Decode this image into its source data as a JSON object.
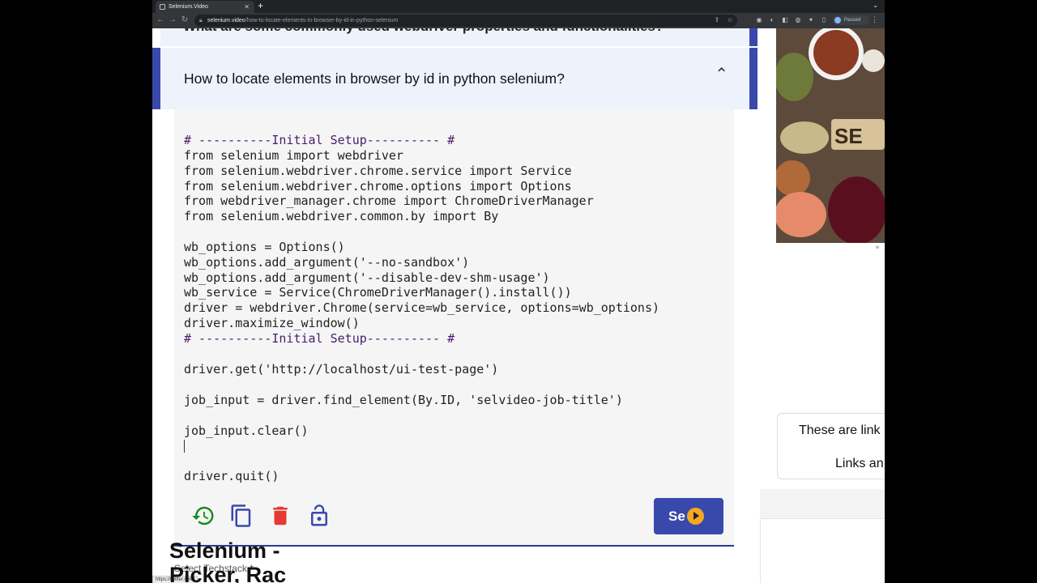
{
  "browser": {
    "tab_title": "Selenium.Video",
    "new_tab": "+",
    "url_host": "selenium.video",
    "url_path": "/how-to-locate-elements-in-browser-by-id-in-python-selenium",
    "profile_status": "Paused",
    "status_url": "https://twitter.com/"
  },
  "page": {
    "prev_question": "What are some commonly used webdriver properties and functionalities?",
    "question": "How to locate elements in browser by id in python selenium?",
    "code_lines": [
      "# ----------Initial Setup---------- #",
      "from selenium import webdriver",
      "from selenium.webdriver.chrome.service import Service",
      "from selenium.webdriver.chrome.options import Options",
      "from webdriver_manager.chrome import ChromeDriverManager",
      "from selenium.webdriver.common.by import By",
      "",
      "wb_options = Options()",
      "wb_options.add_argument('--no-sandbox')",
      "wb_options.add_argument('--disable-dev-shm-usage')",
      "wb_service = Service(ChromeDriverManager().install())",
      "driver = webdriver.Chrome(service=wb_service, options=wb_options)",
      "driver.maximize_window()",
      "# ----------Initial Setup---------- #",
      "",
      "driver.get('http://localhost/ui-test-page')",
      "",
      "job_input = driver.find_element(By.ID, 'selvideo-job-title')",
      "",
      "job_input.clear()",
      "",
      "",
      "driver.quit()"
    ],
    "run_label": "Se",
    "techstack_label": "Select Techstack *"
  },
  "sidebar": {
    "ad_text": "SE",
    "links_line1": "These are link",
    "links_line2": "Links an",
    "promo_line1": "Selenium -",
    "promo_line2": "Picker, Rac"
  },
  "colors": {
    "accent": "#3949ab",
    "play": "#f5a623",
    "history_icon": "#1a8a1a",
    "delete_icon": "#e53935",
    "code_keyword": "#4a1d6b"
  }
}
